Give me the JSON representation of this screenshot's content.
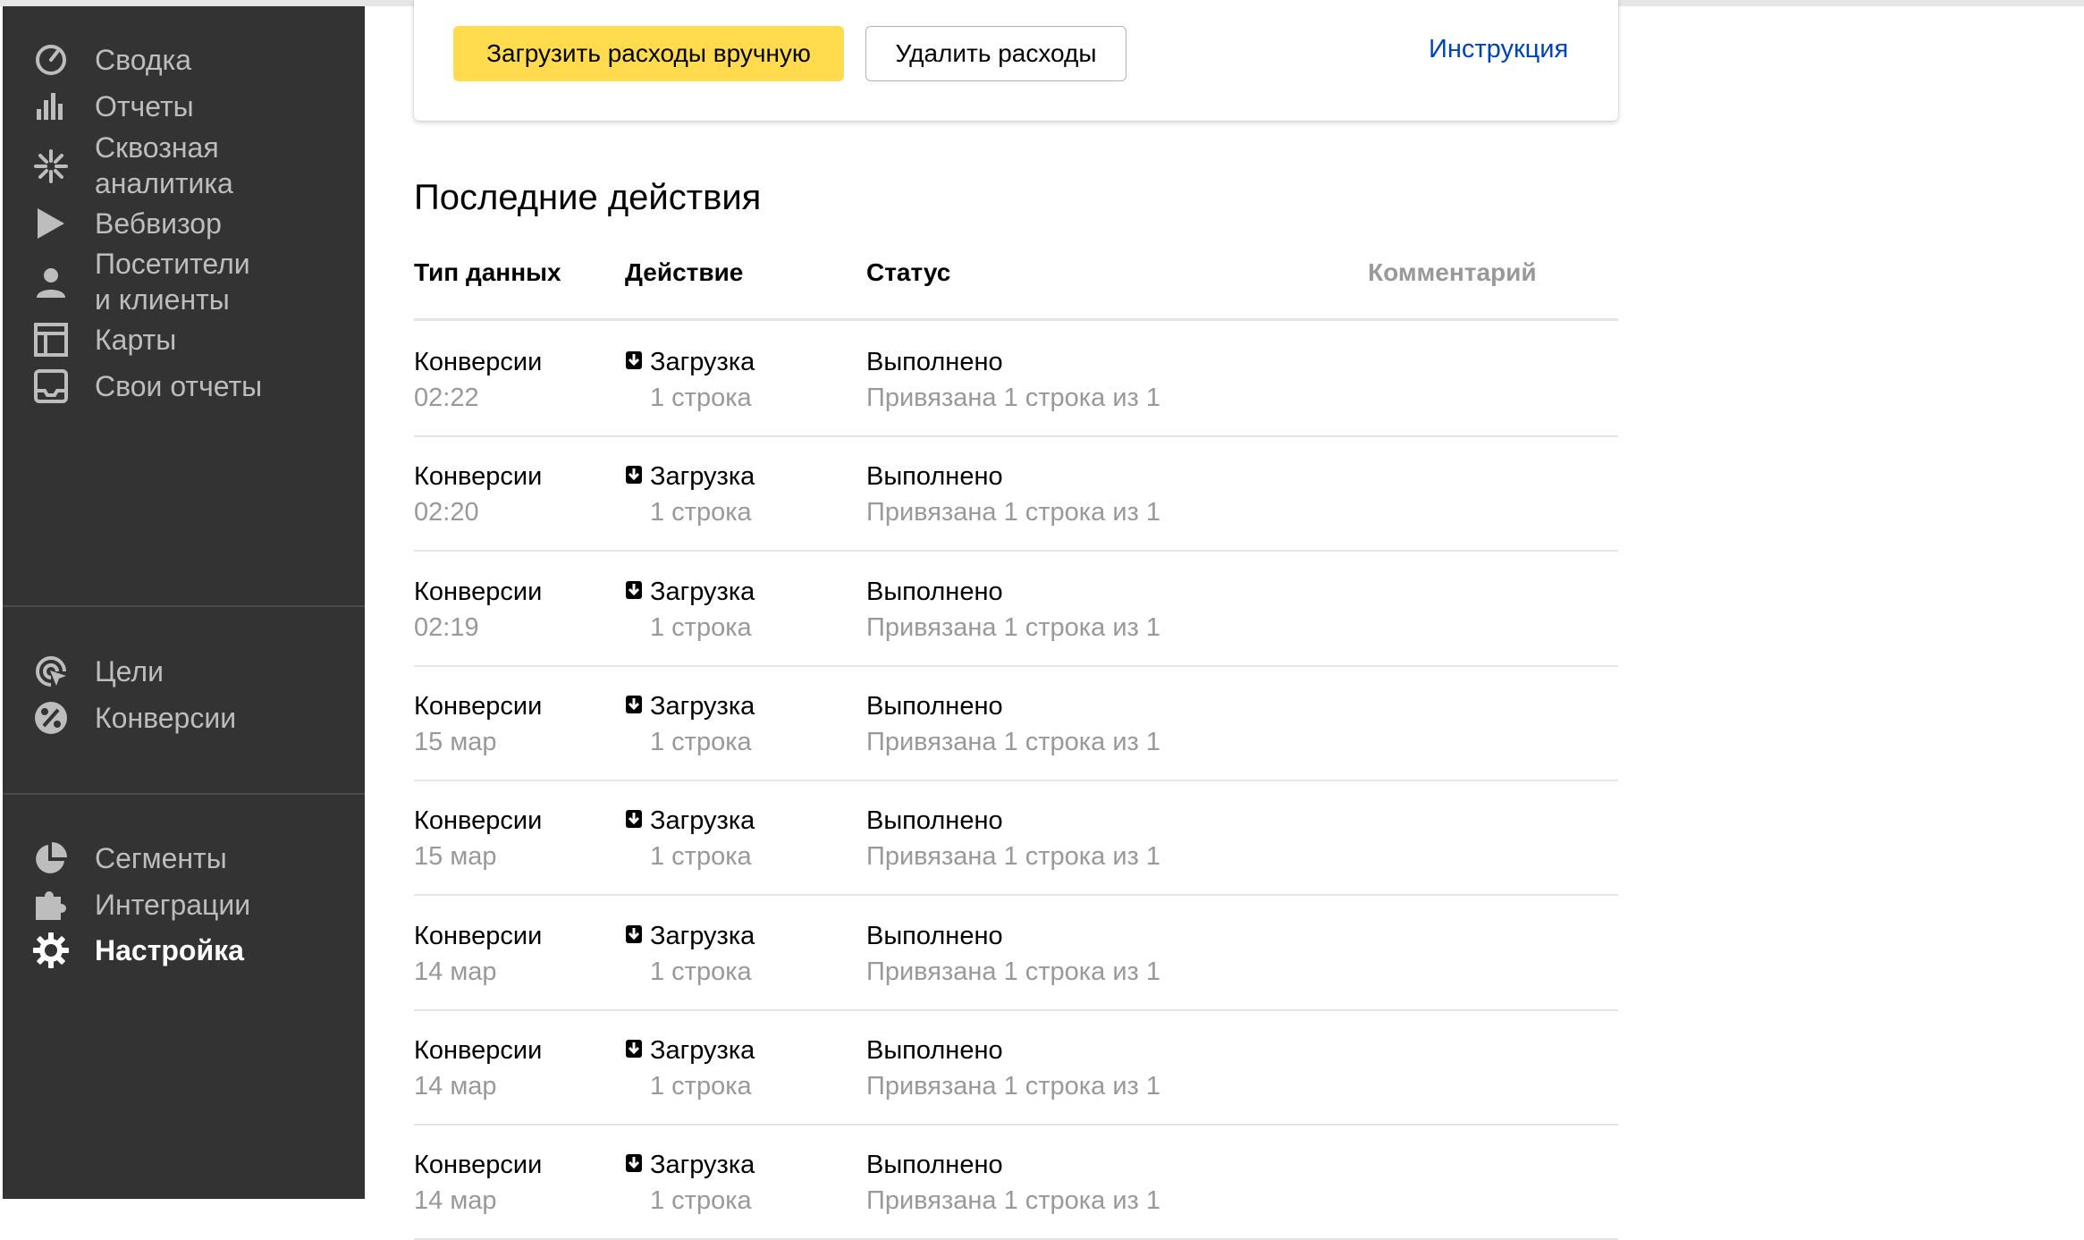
{
  "sidebar": {
    "items": [
      {
        "label": "Сводка",
        "icon": "dashboard-icon"
      },
      {
        "label": "Отчеты",
        "icon": "bar-chart-icon"
      },
      {
        "label": "Сквозная\nаналитика",
        "icon": "asterisk-icon"
      },
      {
        "label": "Вебвизор",
        "icon": "play-icon"
      },
      {
        "label": "Посетители\nи клиенты",
        "icon": "person-icon"
      },
      {
        "label": "Карты",
        "icon": "layout-map-icon"
      },
      {
        "label": "Свои отчеты",
        "icon": "inbox-icon"
      },
      {
        "label": "Цели",
        "icon": "target-cursor-icon"
      },
      {
        "label": "Конверсии",
        "icon": "percent-icon"
      },
      {
        "label": "Сегменты",
        "icon": "pie-icon"
      },
      {
        "label": "Интеграции",
        "icon": "puzzle-icon"
      },
      {
        "label": "Настройка",
        "icon": "gear-icon",
        "active": true
      }
    ]
  },
  "card": {
    "upload_button": "Загрузить расходы вручную",
    "delete_button": "Удалить расходы",
    "instruction_link": "Инструкция"
  },
  "recent": {
    "title": "Последние действия",
    "columns": [
      "Тип данных",
      "Действие",
      "Статус",
      "Комментарий"
    ],
    "rows": [
      {
        "type": "Конверсии",
        "time": "02:22",
        "action": "Загрузка",
        "action_detail": "1 строка",
        "status": "Выполнено",
        "status_detail": "Привязана 1 строка из 1"
      },
      {
        "type": "Конверсии",
        "time": "02:20",
        "action": "Загрузка",
        "action_detail": "1 строка",
        "status": "Выполнено",
        "status_detail": "Привязана 1 строка из 1"
      },
      {
        "type": "Конверсии",
        "time": "02:19",
        "action": "Загрузка",
        "action_detail": "1 строка",
        "status": "Выполнено",
        "status_detail": "Привязана 1 строка из 1"
      },
      {
        "type": "Конверсии",
        "time": "15 мар",
        "action": "Загрузка",
        "action_detail": "1 строка",
        "status": "Выполнено",
        "status_detail": "Привязана 1 строка из 1"
      },
      {
        "type": "Конверсии",
        "time": "15 мар",
        "action": "Загрузка",
        "action_detail": "1 строка",
        "status": "Выполнено",
        "status_detail": "Привязана 1 строка из 1"
      },
      {
        "type": "Конверсии",
        "time": "14 мар",
        "action": "Загрузка",
        "action_detail": "1 строка",
        "status": "Выполнено",
        "status_detail": "Привязана 1 строка из 1"
      },
      {
        "type": "Конверсии",
        "time": "14 мар",
        "action": "Загрузка",
        "action_detail": "1 строка",
        "status": "Выполнено",
        "status_detail": "Привязана 1 строка из 1"
      },
      {
        "type": "Конверсии",
        "time": "14 мар",
        "action": "Загрузка",
        "action_detail": "1 строка",
        "status": "Выполнено",
        "status_detail": "Привязана 1 строка из 1"
      }
    ]
  },
  "colors": {
    "sidebar_bg": "#333333",
    "accent_yellow": "#ffdb4d",
    "link_blue": "#0044bb",
    "muted_text": "#999999"
  }
}
